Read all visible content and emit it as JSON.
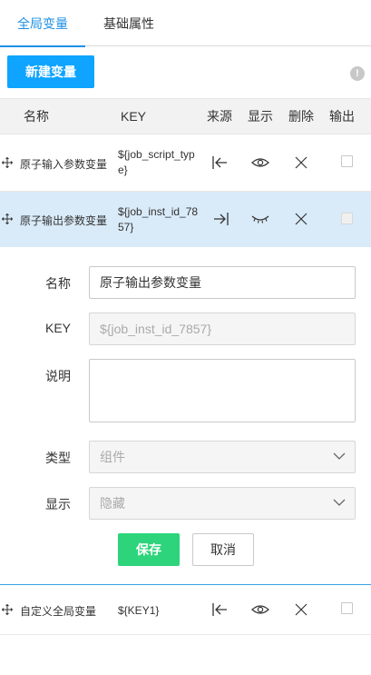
{
  "tabs": [
    {
      "label": "全局变量",
      "active": true
    },
    {
      "label": "基础属性",
      "active": false
    }
  ],
  "toolbar": {
    "new_label": "新建变量",
    "info_icon": "info-icon"
  },
  "table": {
    "headers": {
      "name": "名称",
      "key": "KEY",
      "source": "来源",
      "display": "显示",
      "delete": "删除",
      "output": "输出"
    },
    "rows": [
      {
        "name": "原子输入参数变量",
        "key": "${job_script_type}",
        "source_icon": "source-input-icon",
        "display_icon": "eye-open-icon",
        "output_checked": false
      },
      {
        "name": "原子输出参数变量",
        "key": "${job_inst_id_7857}",
        "source_icon": "source-output-icon",
        "display_icon": "eye-closed-icon",
        "output_checked": false
      },
      {
        "name": "自定义全局变量",
        "key": "${KEY1}",
        "source_icon": "source-input-icon",
        "display_icon": "eye-open-icon",
        "output_checked": false
      }
    ]
  },
  "form": {
    "name_label": "名称",
    "name_value": "原子输出参数变量",
    "key_label": "KEY",
    "key_value": "${job_inst_id_7857}",
    "desc_label": "说明",
    "desc_value": "",
    "type_label": "类型",
    "type_value": "组件",
    "display_label": "显示",
    "display_value": "隐藏",
    "save_label": "保存",
    "cancel_label": "取消"
  },
  "colors": {
    "accent": "#1e90e6",
    "primary_button": "#0ea4ff",
    "save_button": "#2dd47b",
    "selected_row": "#d9eaf8"
  }
}
